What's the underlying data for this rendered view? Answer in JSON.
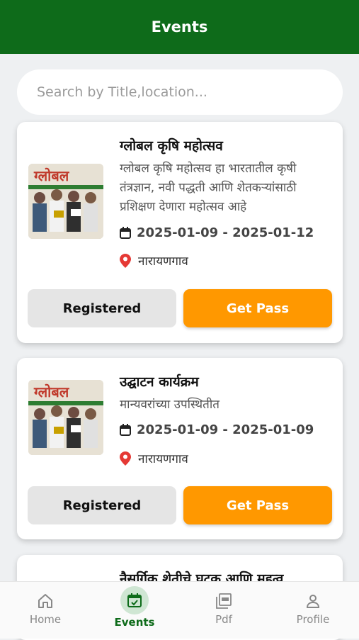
{
  "header": {
    "title": "Events"
  },
  "search": {
    "placeholder": "Search by Title,location..."
  },
  "events": [
    {
      "title": "ग्लोबल कृषि महोत्सव",
      "description": "ग्लोबल कृषि महोत्सव हा भारतातील कृषी तंत्रज्ञान, नवी पद्धती आणि शेतकऱ्यांसाठी प्रशिक्षण देणारा महोत्सव आहे",
      "date": "2025-01-09 - 2025-01-12",
      "location": "नारायणगाव",
      "registered_label": "Registered",
      "pass_label": "Get Pass",
      "image_text": "ग्लोबल"
    },
    {
      "title": "उद्घाटन कार्यक्रम",
      "description": "मान्यवरांच्या उपस्थितीत",
      "date": "2025-01-09 - 2025-01-09",
      "location": "नारायणगाव",
      "registered_label": "Registered",
      "pass_label": "Get Pass",
      "image_text": "ग्लोबल"
    },
    {
      "title": "नैसर्गिक शेतीचे घटक आणि महत्व"
    }
  ],
  "nav": {
    "items": [
      {
        "label": "Home",
        "icon": "home-icon"
      },
      {
        "label": "Events",
        "icon": "calendar-check-icon"
      },
      {
        "label": "Pdf",
        "icon": "pdf-icon"
      },
      {
        "label": "Profile",
        "icon": "person-icon"
      }
    ],
    "active": "Events"
  },
  "colors": {
    "header": "#0e6b1a",
    "accent": "#ff9800",
    "registered_bg": "#e5e5e5",
    "pin": "#e53935",
    "active_nav": "#0e6b1a"
  }
}
